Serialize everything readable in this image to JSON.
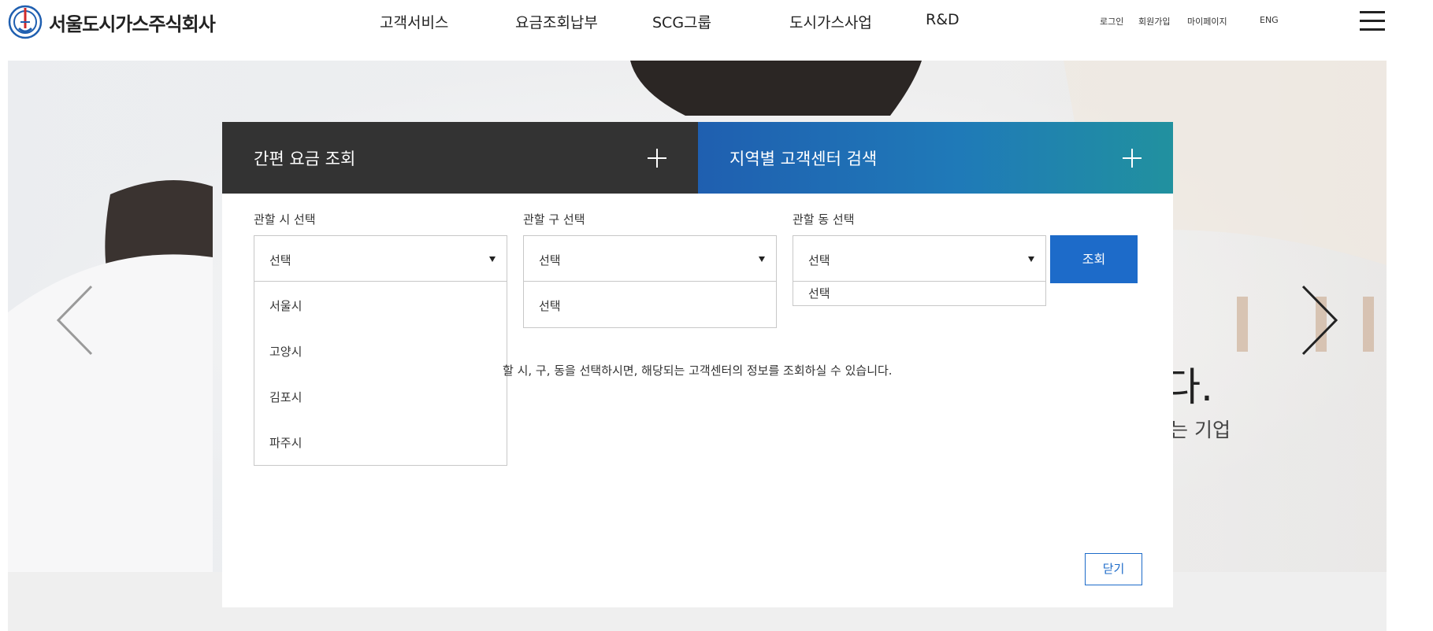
{
  "header": {
    "logo_text": "서울도시가스주식회사",
    "nav": [
      "고객서비스",
      "요금조회납부",
      "SCG그룹",
      "도시가스사업",
      "R&D"
    ],
    "util": [
      "로그인",
      "회원가입",
      "마이페이지",
      "ENG"
    ],
    "brand_color": "#1f5fb0"
  },
  "hero": {
    "big_text": "다.",
    "sub_text": "는 기업"
  },
  "modal": {
    "tabs": [
      {
        "label": "간편 요금 조회",
        "state": "inactive",
        "color": "#333333"
      },
      {
        "label": "지역별 고객센터 검색",
        "state": "active",
        "color": "#1f7ab8"
      }
    ],
    "city": {
      "label": "관할 시 선택",
      "value": "선택",
      "options": [
        "서울시",
        "고양시",
        "김포시",
        "파주시"
      ]
    },
    "district": {
      "label": "관할 구 선택",
      "value": "선택",
      "options": [
        "선택"
      ]
    },
    "dong": {
      "label": "관할 동 선택",
      "value": "선택",
      "options": [
        "선택"
      ]
    },
    "search_label": "조회",
    "info_text": "할 시, 구, 동을 선택하시면, 해당되는 고객센터의 정보를 조회하실 수 있습니다.",
    "close_label": "닫기"
  },
  "icons": {
    "prev": "chevron-left-icon",
    "next": "chevron-right-icon",
    "menu": "hamburger-icon",
    "caret": "caret-down-icon",
    "expand": "plus-icon"
  }
}
